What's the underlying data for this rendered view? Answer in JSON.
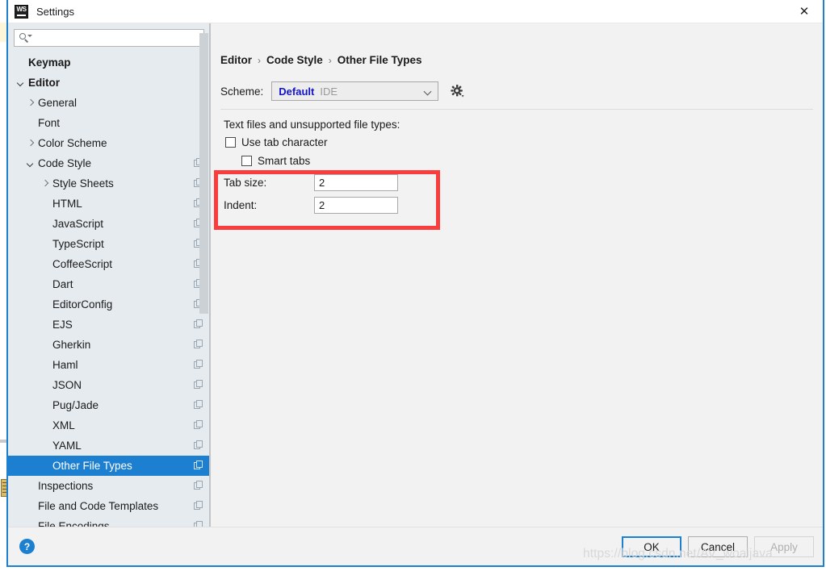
{
  "window": {
    "title": "Settings",
    "logo_text": "WS",
    "close_icon": "close-icon"
  },
  "sidebar": {
    "search": {
      "placeholder": "",
      "value": "",
      "icon": "search-icon"
    },
    "items": [
      {
        "label": "Keymap",
        "indent": 0,
        "bold": true,
        "twisty": "none",
        "copy": false,
        "selected": false
      },
      {
        "label": "Editor",
        "indent": 0,
        "bold": true,
        "twisty": "down",
        "copy": false,
        "selected": false
      },
      {
        "label": "General",
        "indent": 1,
        "bold": false,
        "twisty": "right",
        "copy": false,
        "selected": false
      },
      {
        "label": "Font",
        "indent": 1,
        "bold": false,
        "twisty": "none",
        "copy": false,
        "selected": false
      },
      {
        "label": "Color Scheme",
        "indent": 1,
        "bold": false,
        "twisty": "right",
        "copy": false,
        "selected": false
      },
      {
        "label": "Code Style",
        "indent": 1,
        "bold": false,
        "twisty": "down",
        "copy": true,
        "selected": false
      },
      {
        "label": "Style Sheets",
        "indent": 2,
        "bold": false,
        "twisty": "right",
        "copy": true,
        "selected": false
      },
      {
        "label": "HTML",
        "indent": 2,
        "bold": false,
        "twisty": "none",
        "copy": true,
        "selected": false
      },
      {
        "label": "JavaScript",
        "indent": 2,
        "bold": false,
        "twisty": "none",
        "copy": true,
        "selected": false
      },
      {
        "label": "TypeScript",
        "indent": 2,
        "bold": false,
        "twisty": "none",
        "copy": true,
        "selected": false
      },
      {
        "label": "CoffeeScript",
        "indent": 2,
        "bold": false,
        "twisty": "none",
        "copy": true,
        "selected": false
      },
      {
        "label": "Dart",
        "indent": 2,
        "bold": false,
        "twisty": "none",
        "copy": true,
        "selected": false
      },
      {
        "label": "EditorConfig",
        "indent": 2,
        "bold": false,
        "twisty": "none",
        "copy": true,
        "selected": false
      },
      {
        "label": "EJS",
        "indent": 2,
        "bold": false,
        "twisty": "none",
        "copy": true,
        "selected": false
      },
      {
        "label": "Gherkin",
        "indent": 2,
        "bold": false,
        "twisty": "none",
        "copy": true,
        "selected": false
      },
      {
        "label": "Haml",
        "indent": 2,
        "bold": false,
        "twisty": "none",
        "copy": true,
        "selected": false
      },
      {
        "label": "JSON",
        "indent": 2,
        "bold": false,
        "twisty": "none",
        "copy": true,
        "selected": false
      },
      {
        "label": "Pug/Jade",
        "indent": 2,
        "bold": false,
        "twisty": "none",
        "copy": true,
        "selected": false
      },
      {
        "label": "XML",
        "indent": 2,
        "bold": false,
        "twisty": "none",
        "copy": true,
        "selected": false
      },
      {
        "label": "YAML",
        "indent": 2,
        "bold": false,
        "twisty": "none",
        "copy": true,
        "selected": false
      },
      {
        "label": "Other File Types",
        "indent": 2,
        "bold": false,
        "twisty": "none",
        "copy": true,
        "selected": true
      },
      {
        "label": "Inspections",
        "indent": 1,
        "bold": false,
        "twisty": "none",
        "copy": true,
        "selected": false
      },
      {
        "label": "File and Code Templates",
        "indent": 1,
        "bold": false,
        "twisty": "none",
        "copy": true,
        "selected": false
      },
      {
        "label": "File Encodings",
        "indent": 1,
        "bold": false,
        "twisty": "none",
        "copy": true,
        "selected": false
      }
    ]
  },
  "main": {
    "breadcrumb": [
      "Editor",
      "Code Style",
      "Other File Types"
    ],
    "breadcrumb_separator": "›",
    "scheme": {
      "label": "Scheme:",
      "value": "Default",
      "scope": "IDE",
      "gear_icon": "gear-icon",
      "caret_icon": "chevron-down-icon"
    },
    "section_title": "Text files and unsupported file types:",
    "checkboxes": [
      {
        "label": "Use tab character",
        "checked": false
      },
      {
        "label": "Smart tabs",
        "checked": false
      }
    ],
    "fields": [
      {
        "label": "Tab size:",
        "value": "2"
      },
      {
        "label": "Indent:",
        "value": "2"
      }
    ],
    "highlight_color": "#fa3c3c"
  },
  "footer": {
    "help_icon": "?",
    "ok_label": "OK",
    "cancel_label": "Cancel",
    "apply_label": "Apply"
  },
  "watermark": "https://blog.csdn.net/AV_woaijava",
  "colors": {
    "accent": "#1d7fd0",
    "sidebar_bg": "#e6ebef",
    "main_bg": "#f2f2f2",
    "scheme_value": "#1414cc",
    "highlight": "#fa3c3c"
  }
}
